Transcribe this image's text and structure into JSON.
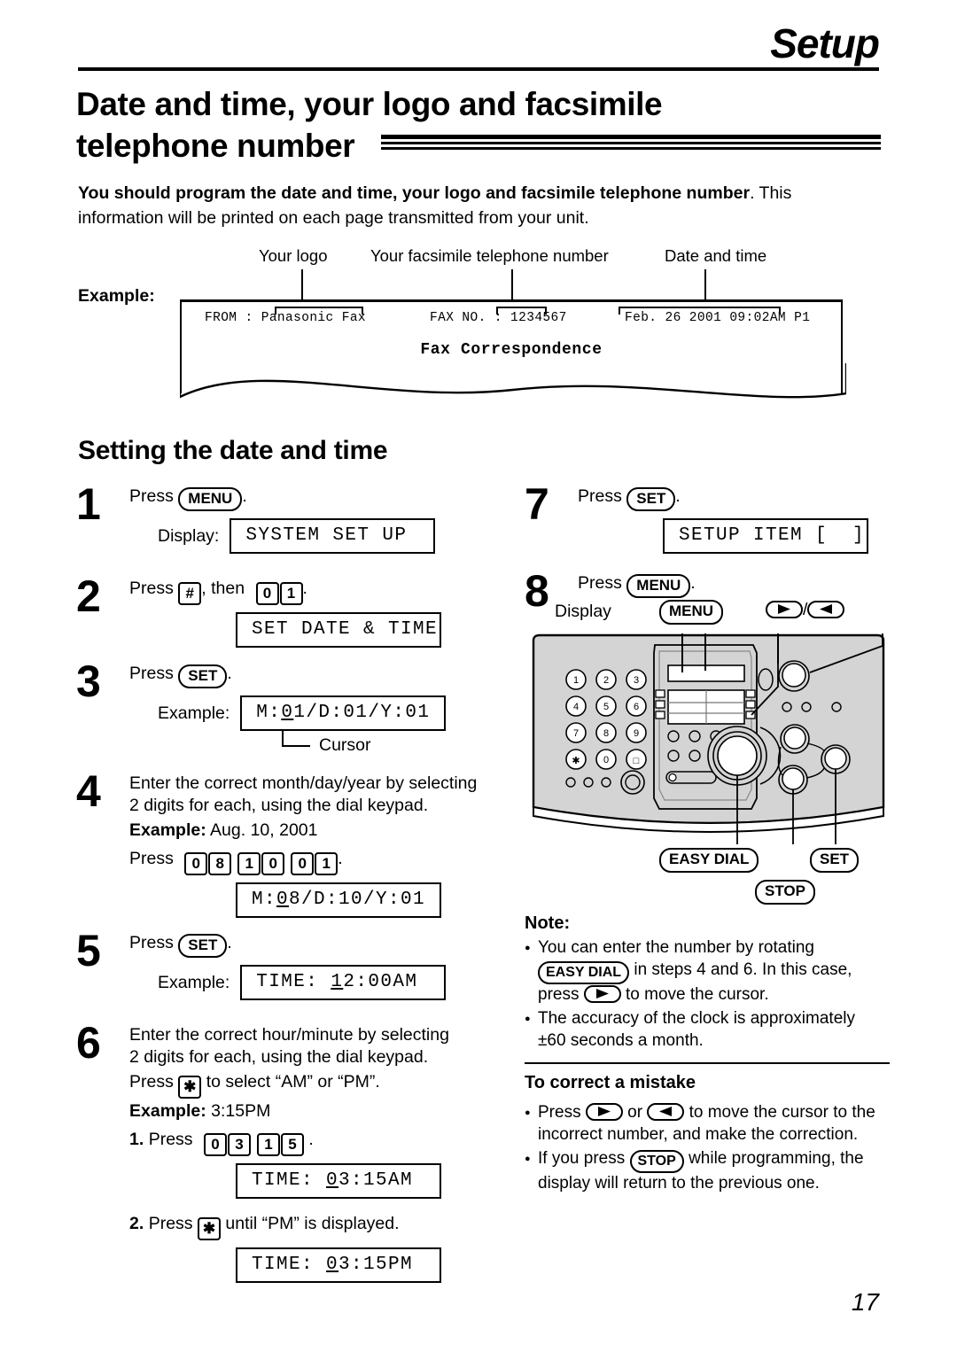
{
  "header": {
    "section_title": "Setup"
  },
  "page_title": {
    "line1": "Date and time, your logo and facsimile",
    "line2": "telephone number"
  },
  "intro": {
    "bold_part": "You should program the date and time, your logo and facsimile telephone number",
    "rest": ". This information will be printed on each page transmitted from your unit."
  },
  "example": {
    "label": "Example:",
    "callouts": {
      "logo": "Your logo",
      "fax_number": "Your facsimile telephone number",
      "date_time": "Date and time"
    },
    "fax_header": {
      "from_label": "FROM :",
      "from_value": "Panasonic Fax",
      "faxno_label": "FAX NO. :",
      "faxno_value": "1234567",
      "datetime_value": "Feb. 26 2001 09:02AM",
      "page_marker": "P1"
    },
    "document_title": "Fax Correspondence"
  },
  "section": {
    "heading": "Setting the date and time"
  },
  "steps_left": [
    {
      "num": "1",
      "press_label": "Press",
      "key": "MENU",
      "period": ".",
      "display_label": "Display:",
      "display_text": "SYSTEM SET UP"
    },
    {
      "num": "2",
      "press_label": "Press",
      "key_hash": "#",
      "then_label": ", then",
      "keys": [
        "0",
        "1"
      ],
      "period": ".",
      "display_text": "SET DATE & TIME"
    },
    {
      "num": "3",
      "press_label": "Press",
      "key": "SET",
      "period": ".",
      "display_label": "Example:",
      "display_pre": "M:",
      "display_cursor_char": "0",
      "display_post": "1/D:01/Y:01",
      "cursor_label": "Cursor"
    },
    {
      "num": "4",
      "instruction_line1": "Enter the correct month/day/year by selecting",
      "instruction_line2": "2 digits for each, using the dial keypad.",
      "example_label": "Example:",
      "example_value": "Aug. 10, 2001",
      "press_label": "Press",
      "keys": [
        "0",
        "8",
        "1",
        "0",
        "0",
        "1"
      ],
      "period": ".",
      "display_pre": "M:",
      "display_cursor_char": "0",
      "display_post": "8/D:10/Y:01"
    },
    {
      "num": "5",
      "press_label": "Press",
      "key": "SET",
      "period": ".",
      "display_label": "Example:",
      "display_pre": "TIME: ",
      "display_cursor_char": "1",
      "display_post": "2:00AM"
    },
    {
      "num": "6",
      "instruction_line1": "Enter the correct hour/minute by selecting",
      "instruction_line2": "2 digits for each, using the dial keypad.",
      "press_label": "Press",
      "key_star": "✱",
      "instruction_line3": "to select “AM” or “PM”.",
      "example_label": "Example:",
      "example_value": "3:15PM",
      "sub1_num": "1.",
      "sub1_press": "Press",
      "sub1_keys": [
        "0",
        "3",
        "1",
        "5"
      ],
      "sub1_period": ".",
      "sub1_display_pre": "TIME: ",
      "sub1_display_cursor_char": "0",
      "sub1_display_post": "3:15AM",
      "sub2_num": "2.",
      "sub2_press": "Press",
      "sub2_tail": "until “PM” is displayed.",
      "sub2_display_pre": "TIME: ",
      "sub2_display_cursor_char": "0",
      "sub2_display_post": "3:15PM"
    }
  ],
  "steps_right": [
    {
      "num": "7",
      "press_label": "Press",
      "key": "SET",
      "period": ".",
      "display_text": "SETUP ITEM [  ]"
    },
    {
      "num": "8",
      "press_label": "Press",
      "key": "MENU",
      "period": "."
    }
  ],
  "illustration": {
    "display_caption": "Display",
    "menu_key": "MENU",
    "arrow_separator": "/",
    "keypad": [
      "1",
      "2",
      "3",
      "4",
      "5",
      "6",
      "7",
      "8",
      "9",
      "✱",
      "0",
      "□"
    ],
    "labels": {
      "easy_dial": "EASY DIAL",
      "set": "SET",
      "stop": "STOP"
    }
  },
  "note": {
    "heading": "Note:",
    "items": [
      {
        "pre": "You can enter the number by rotating",
        "key": "EASY DIAL",
        "mid": "in steps 4 and 6. In this case,",
        "press_word": "press",
        "post": "to move the cursor."
      },
      {
        "pre": "The accuracy of the clock is approximately",
        "post": "±60 seconds a month."
      }
    ]
  },
  "correct_mistake": {
    "heading": "To correct a mistake",
    "items": [
      {
        "press_word": "Press",
        "or_word": "or",
        "tail1": "to move the cursor to the",
        "tail2": "incorrect number, and make the correction."
      },
      {
        "pre": "If you press",
        "key": "STOP",
        "tail1": "while programming, the",
        "tail2": "display will return to the previous one."
      }
    ]
  },
  "page_number": "17"
}
